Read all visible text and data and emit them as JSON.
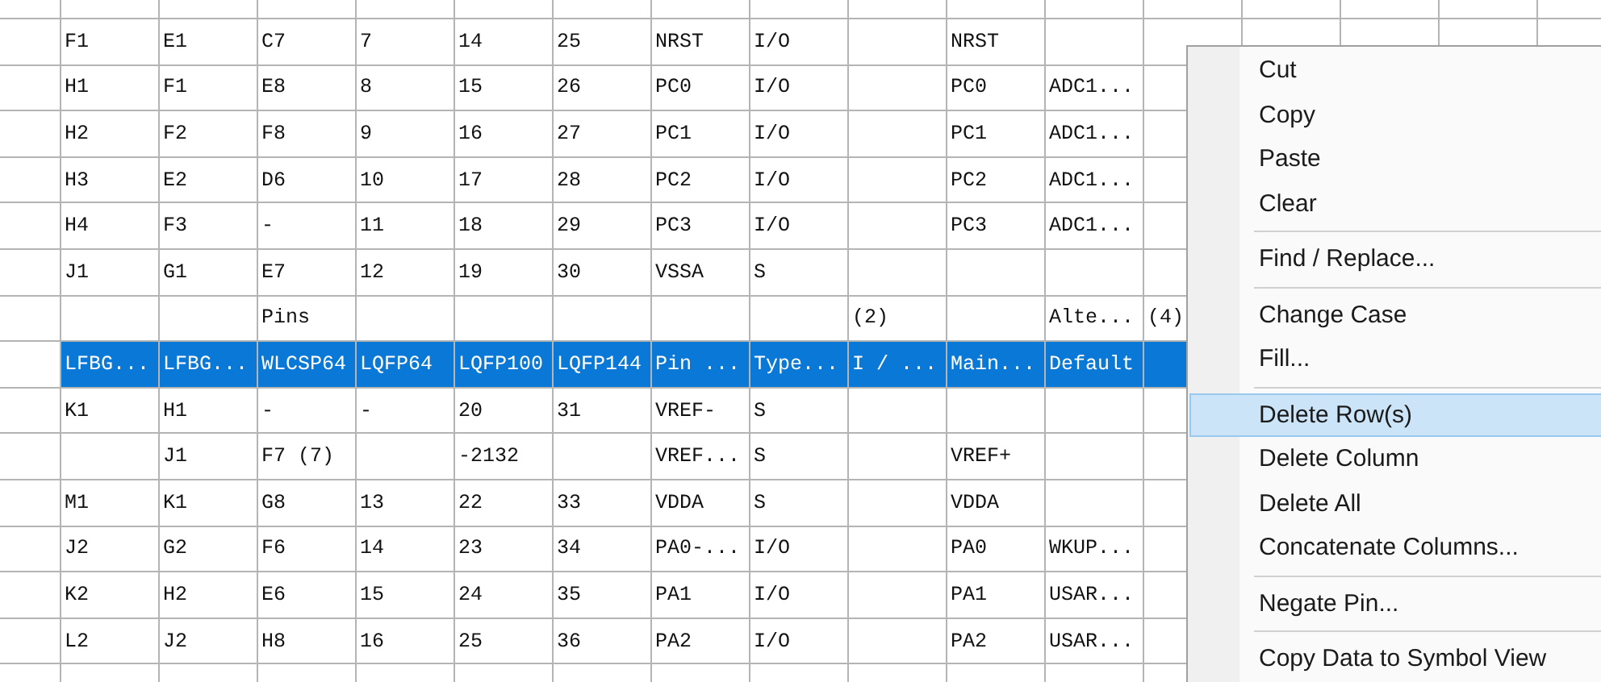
{
  "table": {
    "rows": [
      {
        "selected": false,
        "cells": [
          "F1",
          "E1",
          "C7",
          "7",
          "14",
          "25",
          "NRST",
          "I/O",
          "",
          "NRST",
          "",
          ""
        ]
      },
      {
        "selected": false,
        "cells": [
          "H1",
          "F1",
          "E8",
          "8",
          "15",
          "26",
          "PC0",
          "I/O",
          "",
          "PC0",
          "ADC1...",
          ""
        ]
      },
      {
        "selected": false,
        "cells": [
          "H2",
          "F2",
          "F8",
          "9",
          "16",
          "27",
          "PC1",
          "I/O",
          "",
          "PC1",
          "ADC1...",
          ""
        ]
      },
      {
        "selected": false,
        "cells": [
          "H3",
          "E2",
          "D6",
          "10",
          "17",
          "28",
          "PC2",
          "I/O",
          "",
          "PC2",
          "ADC1...",
          ""
        ]
      },
      {
        "selected": false,
        "cells": [
          "H4",
          "F3",
          "-",
          "11",
          "18",
          "29",
          "PC3",
          "I/O",
          "",
          "PC3",
          "ADC1...",
          ""
        ]
      },
      {
        "selected": false,
        "cells": [
          "J1",
          "G1",
          "E7",
          "12",
          "19",
          "30",
          "VSSA",
          "S",
          "",
          "",
          "",
          ""
        ]
      },
      {
        "selected": false,
        "cells": [
          "",
          "",
          "Pins",
          "",
          "",
          "",
          "",
          "",
          "(2)",
          "",
          "Alte...",
          "(4)"
        ]
      },
      {
        "selected": true,
        "cells": [
          "LFBG...",
          "LFBG...",
          "WLCSP64",
          "LQFP64",
          "LQFP100",
          "LQFP144",
          "Pin ...",
          "Type...",
          "I / ...",
          "Main...",
          "Default",
          ""
        ]
      },
      {
        "selected": false,
        "cells": [
          "K1",
          "H1",
          "-",
          "-",
          "20",
          "31",
          "VREF-",
          "S",
          "",
          "",
          "",
          ""
        ]
      },
      {
        "selected": false,
        "cells": [
          "",
          "J1",
          "F7 (7)",
          "",
          "-2132",
          "",
          "VREF...",
          "S",
          "",
          "VREF+",
          "",
          ""
        ]
      },
      {
        "selected": false,
        "cells": [
          "M1",
          "K1",
          "G8",
          "13",
          "22",
          "33",
          "VDDA",
          "S",
          "",
          "VDDA",
          "",
          ""
        ]
      },
      {
        "selected": false,
        "cells": [
          "J2",
          "G2",
          "F6",
          "14",
          "23",
          "34",
          "PA0-...",
          "I/O",
          "",
          "PA0",
          "WKUP...",
          ""
        ]
      },
      {
        "selected": false,
        "cells": [
          "K2",
          "H2",
          "E6",
          "15",
          "24",
          "35",
          "PA1",
          "I/O",
          "",
          "PA1",
          "USAR...",
          ""
        ]
      },
      {
        "selected": false,
        "cells": [
          "L2",
          "J2",
          "H8",
          "16",
          "25",
          "36",
          "PA2",
          "I/O",
          "",
          "PA2",
          "USAR...",
          ""
        ]
      }
    ]
  },
  "context_menu": {
    "items": [
      {
        "kind": "item",
        "label": "Cut",
        "selected": false
      },
      {
        "kind": "item",
        "label": "Copy",
        "selected": false
      },
      {
        "kind": "item",
        "label": "Paste",
        "selected": false
      },
      {
        "kind": "item",
        "label": "Clear",
        "selected": false
      },
      {
        "kind": "separator"
      },
      {
        "kind": "item",
        "label": "Find / Replace...",
        "selected": false
      },
      {
        "kind": "separator"
      },
      {
        "kind": "item",
        "label": "Change Case",
        "selected": false
      },
      {
        "kind": "item",
        "label": "Fill...",
        "selected": false
      },
      {
        "kind": "separator"
      },
      {
        "kind": "item",
        "label": "Delete Row(s)",
        "selected": true
      },
      {
        "kind": "item",
        "label": "Delete Column",
        "selected": false
      },
      {
        "kind": "item",
        "label": "Delete All",
        "selected": false
      },
      {
        "kind": "item",
        "label": "Concatenate Columns...",
        "selected": false
      },
      {
        "kind": "separator"
      },
      {
        "kind": "item",
        "label": "Negate Pin...",
        "selected": false
      },
      {
        "kind": "separator"
      },
      {
        "kind": "item",
        "label": "Copy Data to Symbol View",
        "selected": false
      }
    ]
  }
}
